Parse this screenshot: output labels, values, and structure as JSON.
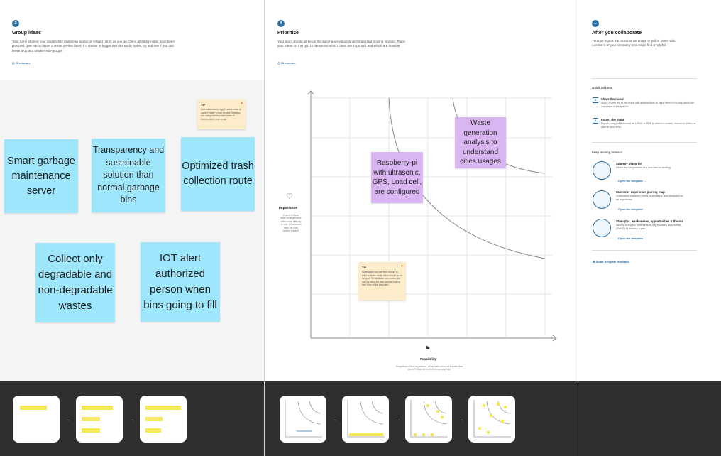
{
  "panels": {
    "group": {
      "step": "3",
      "title": "Group ideas",
      "description": "Take turns sharing your ideas while clustering similar or related notes as you go. Once all sticky notes have been grouped, give each cluster a sentence-like label. If a cluster is bigger than six sticky notes, try and see if you can break it up into smaller sub-groups.",
      "timer": "20 minutes",
      "tip": {
        "label": "TIP",
        "text": "Add customizable tags to sticky notes to make it easier to find, browse, organize, and categorize important ideas as themes within your mural."
      },
      "notes": [
        "Smart garbage maintenance server",
        "Transparency and sustainable solution than normal garbage bins",
        "Optimized trash collection route",
        "Collect only degradable and non-degradable wastes",
        "IOT alert authorized person when bins going to fill"
      ]
    },
    "prioritize": {
      "step": "4",
      "title": "Prioritize",
      "description": "Your team should all be on the same page about what's important moving forward. Place your ideas on this grid to determine which ideas are important and which are feasible.",
      "timer": "20 minutes",
      "y_axis_label": "Importance",
      "y_axis_desc": "If each of these tasks could get done without any difficulty or cost, which would have the most positive impact?",
      "x_axis_label": "Feasibility",
      "x_axis_desc": "Regardless of their importance, which tasks are more feasible than others? (Cost, time, effort, complexity, etc.)",
      "tip": {
        "label": "TIP",
        "text": "Participants can use their cursors to point at where sticky notes should go on the grid. The facilitator can confirm the spot by using the laser pointer holding the H key on the keyboard."
      },
      "notes": [
        "Raspberry-pi with ultrasonic, GPS, Load cell, are configured",
        "Waste generation analysis to understand cities usages"
      ]
    },
    "after": {
      "title": "After you collaborate",
      "description": "You can export the mural as an image or pdf to share with members of your company who might find it helpful.",
      "quick_addons": "Quick add-ons",
      "addons": [
        {
          "icon": "A",
          "title": "Share the mural",
          "desc": "Share a view link to the mural with stakeholders to keep them in the loop about the outcomes of the session."
        },
        {
          "icon": "B",
          "title": "Export the mural",
          "desc": "Export a copy of the mural as a PNG or PDF to attach to emails, include in slides, or save in your drive."
        }
      ],
      "keep_moving": "Keep moving forward",
      "templates": [
        {
          "title": "Strategy blueprint",
          "desc": "Define the components of a new idea or strategy.",
          "link": "Open the template →"
        },
        {
          "title": "Customer experience journey map",
          "desc": "Understand customer needs, motivations, and obstacles for an experience.",
          "link": "Open the template →"
        },
        {
          "title": "Strengths, weaknesses, opportunities & threats",
          "desc": "Identify strengths, weaknesses, opportunities, and threats (SWOT) to develop a plan.",
          "link": "Open the template →"
        }
      ],
      "feedback": "Share template feedback"
    }
  },
  "colors": {
    "blue_note": "#9ee6fb",
    "purple_note": "#d9b5f2",
    "tip_note": "#fdecc9",
    "accent": "#2b6fa3",
    "bottom_bar": "#2f2f2f"
  }
}
